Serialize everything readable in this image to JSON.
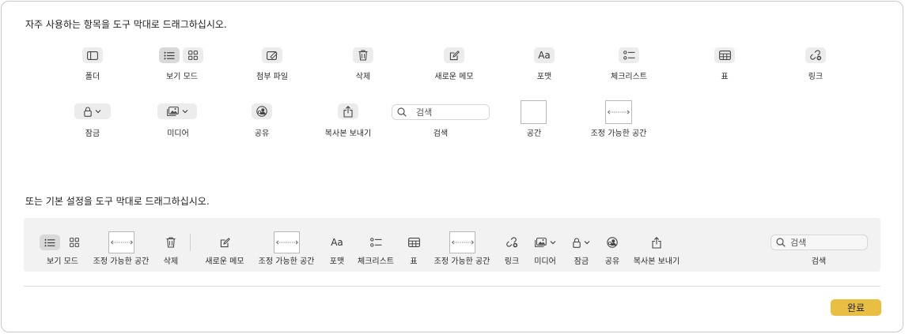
{
  "headings": {
    "custom": "자주 사용하는 항목을 도구 막대로 드래그하십시오.",
    "default": "또는 기본 설정을 도구 막대로 드래그하십시오."
  },
  "palette": {
    "folder": "폴더",
    "view_mode": "보기 모드",
    "attach_file": "첨부 파일",
    "delete": "삭제",
    "new_note": "새로운 메모",
    "format": "포맷",
    "checklist": "체크리스트",
    "table": "표",
    "link": "링크",
    "lock": "잠금",
    "media": "미디어",
    "share": "공유",
    "send_copy": "복사본 보내기",
    "search": "검색",
    "search_placeholder": "검색",
    "space": "공간",
    "flexible_space": "조정 가능한 공간"
  },
  "toolbar": {
    "view_mode": "보기 모드",
    "flexible_space_1": "조정 가능한 공간",
    "delete": "삭제",
    "new_note": "새로운 메모",
    "flexible_space_2": "조정 가능한 공간",
    "format": "포맷",
    "checklist": "체크리스트",
    "table": "표",
    "flexible_space_3": "조정 가능한 공간",
    "link": "링크",
    "media": "미디어",
    "lock": "잠금",
    "share": "공유",
    "send_copy": "복사본 보내기",
    "search": "검색",
    "search_placeholder": "검색"
  },
  "format_glyph": "Aa",
  "done_label": "완료",
  "colors": {
    "accent": "#e8bf43",
    "button_bg": "#ececec",
    "toolbar_bg": "#f2f2f2"
  }
}
